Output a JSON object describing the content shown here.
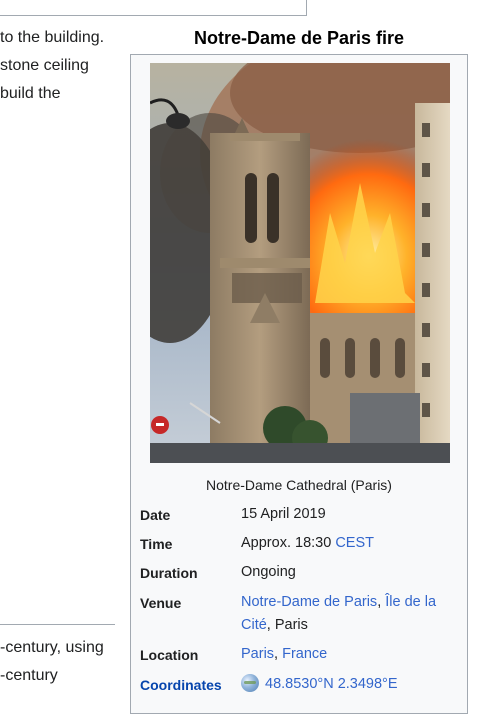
{
  "article": {
    "lines_top": [
      "to the building.",
      "stone ceiling",
      "build the"
    ],
    "lines_bottom": [
      "-century, using",
      "-century"
    ]
  },
  "infobox": {
    "title": "Notre-Dame de Paris fire",
    "image_caption": "Notre-Dame Cathedral (Paris)",
    "rows": {
      "date": {
        "label": "Date",
        "value": "15 April 2019"
      },
      "time": {
        "label": "Time",
        "value_prefix": "Approx. 18:30 ",
        "value_link": "CEST"
      },
      "duration": {
        "label": "Duration",
        "value": "Ongoing"
      },
      "venue": {
        "label": "Venue",
        "link1": "Notre-Dame de Paris",
        "sep": ", ",
        "link2_line1": "Île de la",
        "link2_line2": "Cité",
        "suffix": ", Paris"
      },
      "location": {
        "label": "Location",
        "link1": "Paris",
        "sep": ", ",
        "link2": "France"
      },
      "coordinates": {
        "label": "Coordinates",
        "value": "48.8530°N 2.3498°E",
        "icon": "globe-icon"
      }
    }
  },
  "colors": {
    "link": "#3366cc",
    "border": "#a2a9b1",
    "infobox_bg": "#f8f9fa"
  }
}
